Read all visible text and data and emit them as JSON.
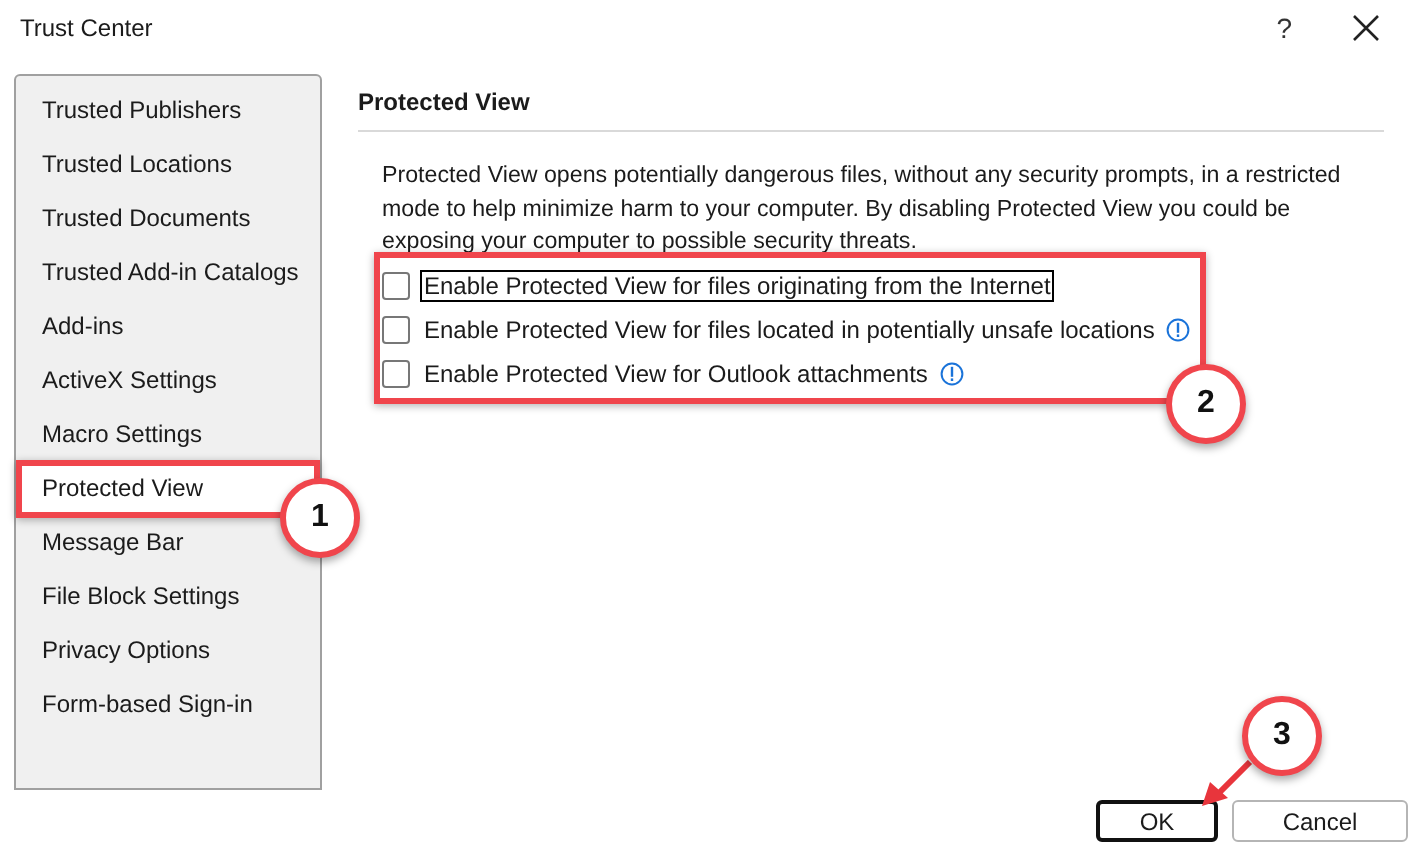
{
  "window": {
    "title": "Trust Center",
    "help": "?"
  },
  "sidebar": {
    "items": [
      {
        "label": "Trusted Publishers",
        "selected": false
      },
      {
        "label": "Trusted Locations",
        "selected": false
      },
      {
        "label": "Trusted Documents",
        "selected": false
      },
      {
        "label": "Trusted Add-in Catalogs",
        "selected": false
      },
      {
        "label": "Add-ins",
        "selected": false
      },
      {
        "label": "ActiveX Settings",
        "selected": false
      },
      {
        "label": "Macro Settings",
        "selected": false
      },
      {
        "label": "Protected View",
        "selected": true
      },
      {
        "label": "Message Bar",
        "selected": false
      },
      {
        "label": "File Block Settings",
        "selected": false
      },
      {
        "label": "Privacy Options",
        "selected": false
      },
      {
        "label": "Form-based Sign-in",
        "selected": false
      }
    ]
  },
  "section": {
    "heading": "Protected View",
    "description": "Protected View opens potentially dangerous files, without any security prompts, in a restricted mode to help minimize harm to your computer. By disabling Protected View you could be exposing your computer to possible security threats.",
    "options": [
      {
        "label": "Enable Protected View for files originating from the Internet",
        "checked": false,
        "focused": true,
        "info": false
      },
      {
        "label": "Enable Protected View for files located in potentially unsafe locations",
        "checked": false,
        "focused": false,
        "info": true
      },
      {
        "label": "Enable Protected View for Outlook attachments",
        "checked": false,
        "focused": false,
        "info": true
      }
    ]
  },
  "buttons": [
    {
      "label": "OK",
      "default": true
    },
    {
      "label": "Cancel",
      "default": false
    }
  ],
  "annotations": [
    {
      "kind": "box",
      "label": "1"
    },
    {
      "kind": "box",
      "label": "2"
    },
    {
      "kind": "arrow",
      "label": "3"
    }
  ]
}
